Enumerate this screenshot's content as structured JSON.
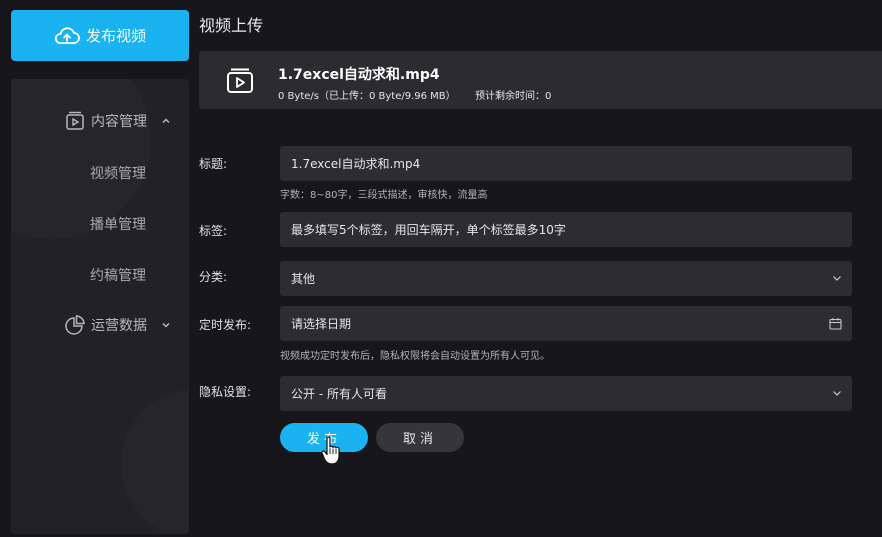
{
  "sidebar": {
    "publish_label": "发布视频",
    "groups": [
      {
        "label": "内容管理",
        "items": [
          "视频管理",
          "播单管理",
          "约稿管理"
        ]
      },
      {
        "label": "运营数据"
      }
    ]
  },
  "main": {
    "title": "视频上传",
    "file": {
      "name": "1.7excel自动求和.mp4",
      "progress": "0 Byte/s（已上传：0 Byte/9.96 MB）",
      "remaining": "预计剩余时间：0"
    },
    "form": {
      "title_label": "标题:",
      "title_value": "1.7excel自动求和.mp4",
      "title_hint": "字数：8~80字，三段式描述，审核快，流量高",
      "tags_label": "标签:",
      "tags_placeholder": "最多填写5个标签，用回车隔开，单个标签最多10字",
      "category_label": "分类:",
      "category_value": "其他",
      "schedule_label": "定时发布:",
      "schedule_placeholder": "请选择日期",
      "schedule_hint": "视频成功定时发布后，隐私权限将会自动设置为所有人可见。",
      "privacy_label": "隐私设置:",
      "privacy_value": "公开 - 所有人可看"
    },
    "buttons": {
      "submit": "发布",
      "cancel": "取消"
    }
  },
  "colors": {
    "accent": "#1ab2f0",
    "background": "#17171b",
    "panel": "#222226",
    "field": "#2c2c31"
  }
}
